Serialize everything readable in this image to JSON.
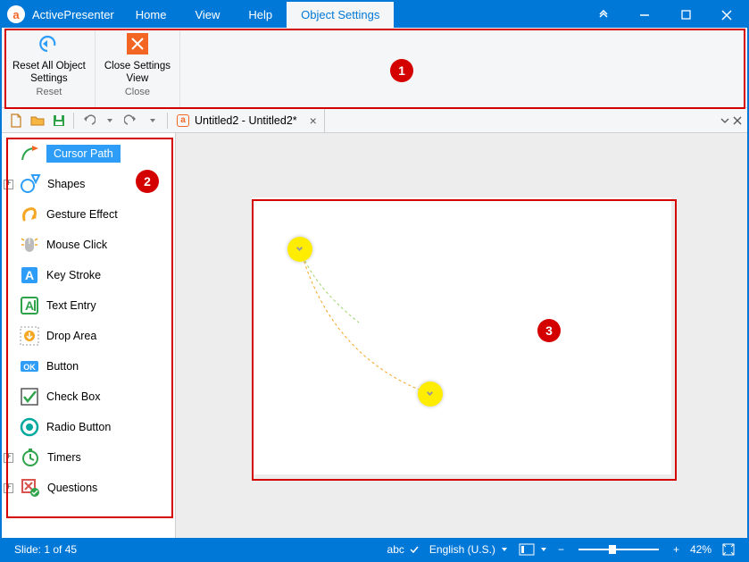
{
  "app": {
    "name": "ActivePresenter"
  },
  "menu": {
    "home": "Home",
    "view": "View",
    "help": "Help",
    "object_settings": "Object Settings"
  },
  "ribbon": {
    "reset_all": {
      "line1": "Reset All Object",
      "line2": "Settings",
      "group": "Reset"
    },
    "close": {
      "line1": "Close Settings",
      "line2": "View",
      "group": "Close"
    }
  },
  "document": {
    "title": "Untitled2 - Untitled2*"
  },
  "sidebar": {
    "cursor_path": "Cursor Path",
    "shapes": "Shapes",
    "gesture_effect": "Gesture Effect",
    "mouse_click": "Mouse Click",
    "key_stroke": "Key Stroke",
    "text_entry": "Text Entry",
    "drop_area": "Drop Area",
    "button": "Button",
    "check_box": "Check Box",
    "radio_button": "Radio Button",
    "timers": "Timers",
    "questions": "Questions"
  },
  "status": {
    "slide": "Slide: 1 of 45",
    "spell": "abc",
    "language": "English (U.S.)",
    "zoom": "42%"
  },
  "annotations": {
    "a1": "1",
    "a2": "2",
    "a3": "3"
  }
}
